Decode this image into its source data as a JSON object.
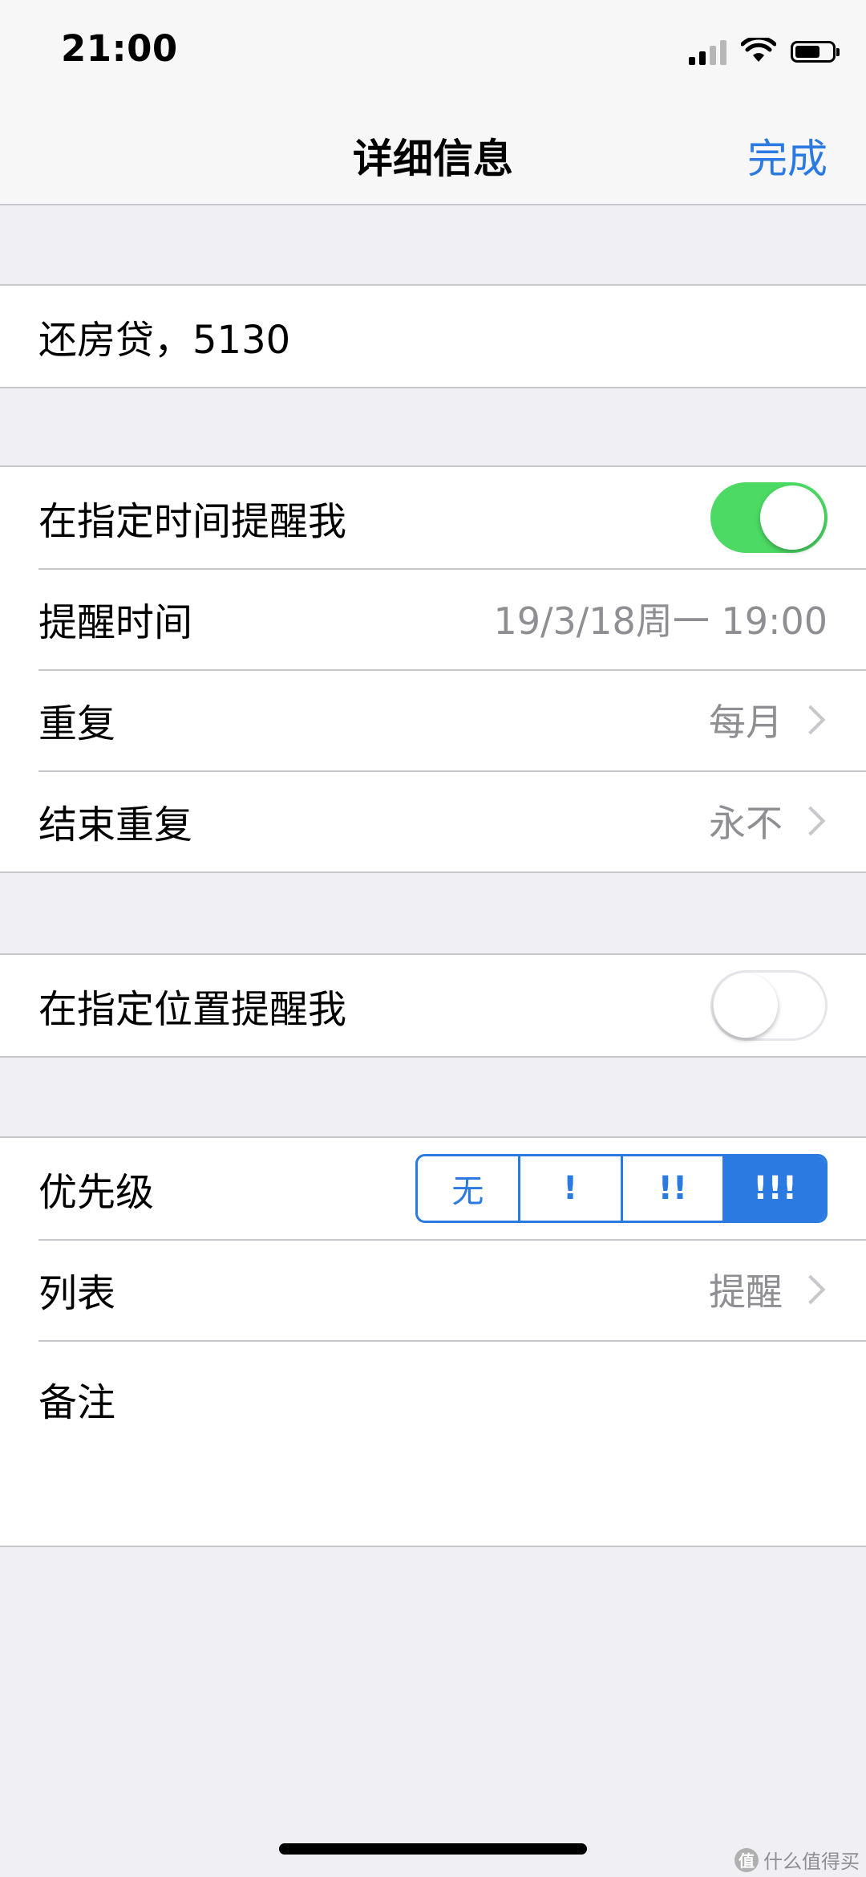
{
  "status_bar": {
    "time": "21:00"
  },
  "nav": {
    "title": "详细信息",
    "done": "完成"
  },
  "title_field": {
    "value": "还房贷，5130"
  },
  "remind_time_section": {
    "toggle_label": "在指定时间提醒我",
    "toggle_on": true,
    "alarm_label": "提醒时间",
    "alarm_value": "19/3/18周一 19:00",
    "repeat_label": "重复",
    "repeat_value": "每月",
    "end_repeat_label": "结束重复",
    "end_repeat_value": "永不"
  },
  "remind_location_section": {
    "toggle_label": "在指定位置提醒我",
    "toggle_on": false
  },
  "details_section": {
    "priority_label": "优先级",
    "priority_options": [
      "无",
      "!",
      "!!",
      "!!!"
    ],
    "priority_selected": "!!!",
    "list_label": "列表",
    "list_value": "提醒",
    "notes_label": "备注"
  },
  "watermark": {
    "text": "什么值得买",
    "logo_char": "值"
  },
  "colors": {
    "accent": "#2a7ae2",
    "toggle_on": "#4cd964",
    "background": "#efeff4"
  }
}
